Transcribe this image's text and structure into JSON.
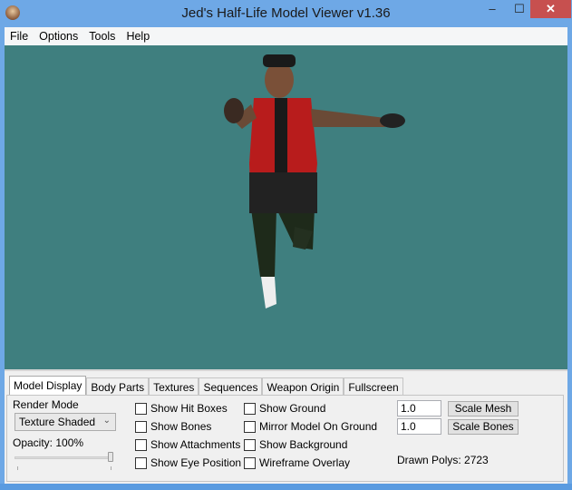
{
  "window": {
    "title": "Jed's Half-Life Model Viewer v1.36",
    "min": "–",
    "max": "☐",
    "close": "✕"
  },
  "menu": [
    "File",
    "Options",
    "Tools",
    "Help"
  ],
  "viewport": {
    "background": "#3f7f7f"
  },
  "tabs": [
    "Model Display",
    "Body Parts",
    "Textures",
    "Sequences",
    "Weapon Origin",
    "Fullscreen"
  ],
  "model_display": {
    "render_mode_label": "Render Mode",
    "render_mode_value": "Texture Shaded",
    "opacity_label": "Opacity: 100%",
    "opacity_value": 1.0,
    "checkboxes_col1": [
      "Show Hit Boxes",
      "Show Bones",
      "Show Attachments",
      "Show Eye Position"
    ],
    "checkboxes_col2": [
      "Show Ground",
      "Mirror Model On Ground",
      "Show Background",
      "Wireframe Overlay"
    ],
    "scale_mesh_value": "1.0",
    "scale_mesh_label": "Scale Mesh",
    "scale_bones_value": "1.0",
    "scale_bones_label": "Scale Bones",
    "drawn_polys": "Drawn Polys: 2723"
  }
}
